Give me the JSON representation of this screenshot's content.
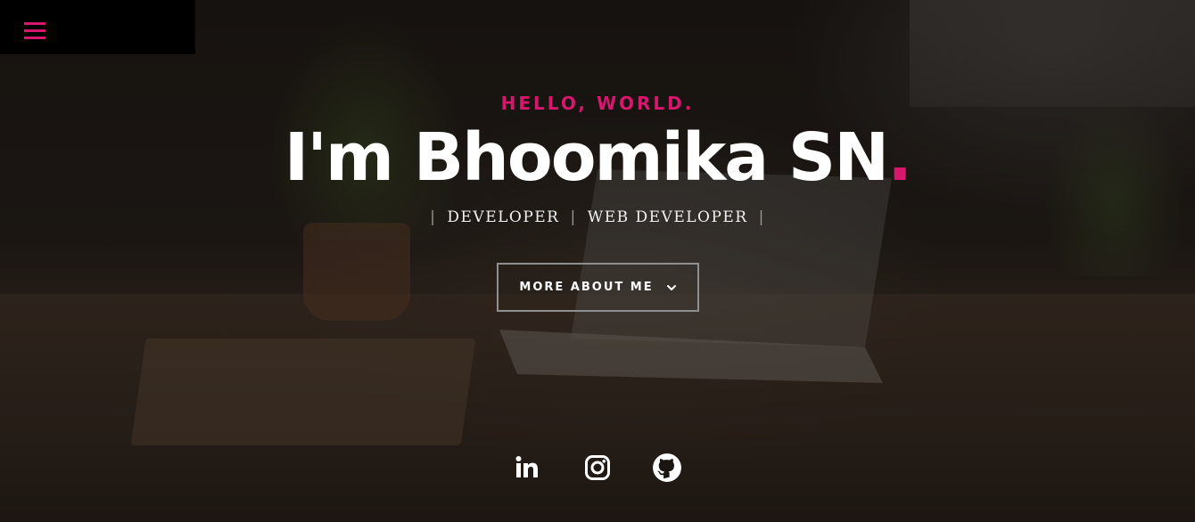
{
  "nav": {
    "menu_icon": "hamburger-menu-icon",
    "accent_color": "#d6176c"
  },
  "hero": {
    "greeting": "HELLO, WORLD.",
    "name_text": "I'm Bhoomika SN",
    "name_dot": ".",
    "roles": [
      "DEVELOPER",
      "WEB DEVELOPER"
    ],
    "role_separator": "|",
    "more_button_label": "MORE ABOUT ME",
    "more_button_icon": "chevron-down-icon"
  },
  "social": [
    {
      "icon": "linkedin-icon"
    },
    {
      "icon": "instagram-icon"
    },
    {
      "icon": "github-icon"
    }
  ]
}
